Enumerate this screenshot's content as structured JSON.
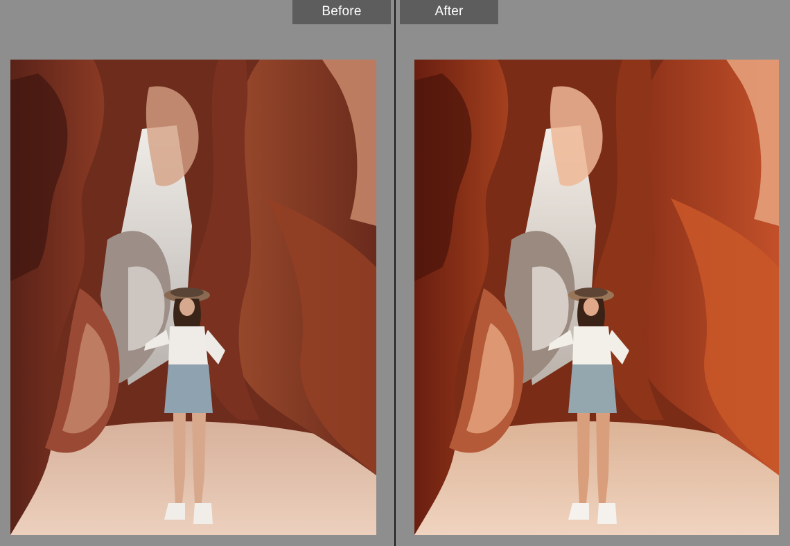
{
  "compare_view": {
    "before_label": "Before",
    "after_label": "After"
  },
  "photos": {
    "before": {
      "icon": "photo-canyon",
      "palette": {
        "wall_dark": "#5a2218",
        "wall_mid": "#8a3a24",
        "wall_light": "#c9805e",
        "sky": "#e8e4e0",
        "floor": "#e6c3ac",
        "floor_shadow": "#c9a18a"
      }
    },
    "after": {
      "icon": "photo-canyon",
      "palette": {
        "wall_dark": "#6a1e10",
        "wall_mid": "#a3401e",
        "wall_light": "#e09a72",
        "sky": "#ece6e0",
        "floor": "#ecccb4",
        "floor_shadow": "#d2a688"
      }
    }
  },
  "colors": {
    "background": "#8e8e8e",
    "label_bg": "#5d5d5d",
    "label_text": "#ffffff",
    "divider": "#1a1a1a"
  }
}
